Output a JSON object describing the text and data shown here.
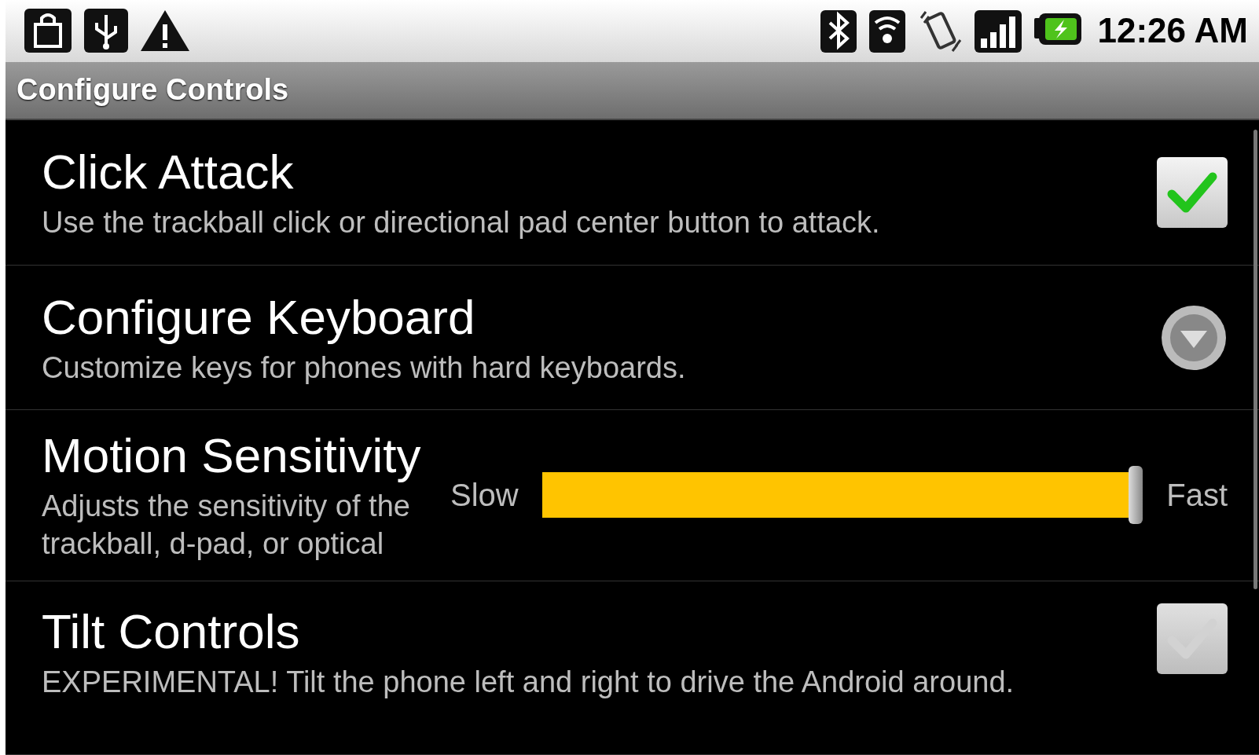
{
  "status_bar": {
    "time": "12:26 AM"
  },
  "title_bar": {
    "title": "Configure Controls"
  },
  "preferences": [
    {
      "kind": "checkbox",
      "title": "Click Attack",
      "summary": "Use the trackball click or directional pad center button to attack.",
      "checked": true
    },
    {
      "kind": "dialog",
      "title": "Configure Keyboard",
      "summary": "Customize keys for phones with hard keyboards."
    },
    {
      "kind": "slider",
      "title": "Motion Sensitivity",
      "summary": "Adjusts the sensitivity of the trackball, d-pad, or optical",
      "min_label": "Slow",
      "max_label": "Fast",
      "level": 1
    },
    {
      "kind": "checkbox",
      "title": "Tilt Controls",
      "summary": "EXPERIMENTAL! Tilt the phone left and right to drive the Android around.",
      "checked": false
    }
  ]
}
